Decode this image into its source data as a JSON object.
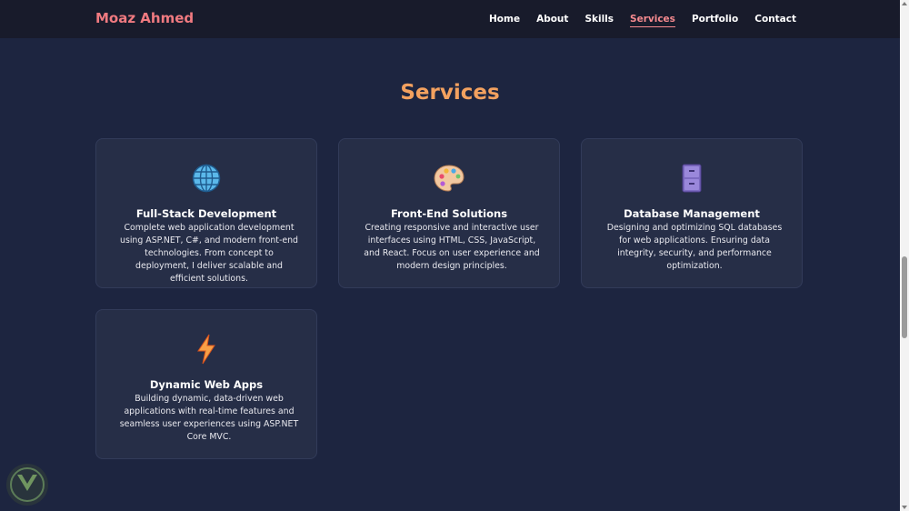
{
  "header": {
    "brand": "Moaz Ahmed",
    "nav": [
      "Home",
      "About",
      "Skills",
      "Services",
      "Portfolio",
      "Contact"
    ],
    "active_nav": "Services"
  },
  "section": {
    "title": "Services"
  },
  "services": [
    {
      "icon": "globe-icon",
      "title": "Full-Stack Development",
      "description": "Complete web application development using ASP.NET, C#, and modern front-end technologies. From concept to deployment, I deliver scalable and efficient solutions."
    },
    {
      "icon": "palette-icon",
      "title": "Front-End Solutions",
      "description": "Creating responsive and interactive user interfaces using HTML, CSS, JavaScript, and React. Focus on user experience and modern design principles."
    },
    {
      "icon": "file-cabinet-icon",
      "title": "Database Management",
      "description": "Designing and optimizing SQL databases for web applications. Ensuring data integrity, security, and performance optimization."
    },
    {
      "icon": "lightning-icon",
      "title": "Dynamic Web Apps",
      "description": "Building dynamic, data-driven web applications with real-time features and seamless user experiences using ASP.NET Core MVC."
    }
  ],
  "colors": {
    "background": "#1d2540",
    "navbar": "#181b2b",
    "brand": "#f07a80",
    "accent": "#f3a15f",
    "card": "#262e47"
  }
}
